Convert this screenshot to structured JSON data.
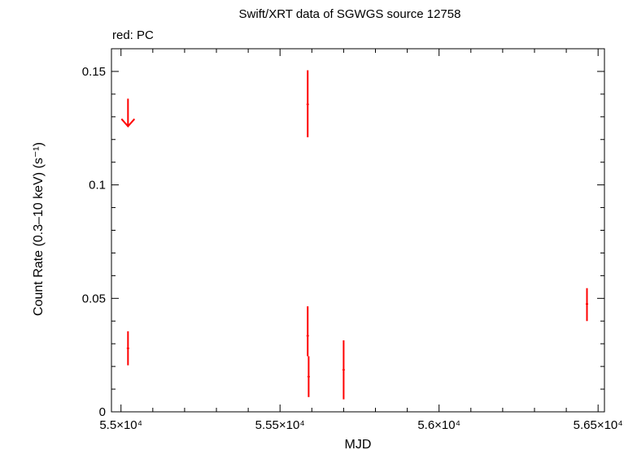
{
  "chart_data": {
    "type": "scatter",
    "title": "Swift/XRT data of SGWGS source 12758",
    "subtitle": "red: PC",
    "xlabel": "MJD",
    "ylabel": "Count Rate (0.3–10 keV) (s⁻¹)",
    "xlim": [
      54970,
      56520
    ],
    "ylim": [
      0,
      0.16
    ],
    "x_ticks": [
      {
        "value": 55000,
        "label": "5.5×10⁴"
      },
      {
        "value": 55500,
        "label": "5.55×10⁴"
      },
      {
        "value": 56000,
        "label": "5.6×10⁴"
      },
      {
        "value": 56500,
        "label": "5.65×10⁴"
      }
    ],
    "y_ticks": [
      {
        "value": 0,
        "label": "0"
      },
      {
        "value": 0.05,
        "label": "0.05"
      },
      {
        "value": 0.1,
        "label": "0.1"
      },
      {
        "value": 0.15,
        "label": "0.15"
      }
    ],
    "series": [
      {
        "color": "#ff0000",
        "points": [
          {
            "x": 55022,
            "y": 0.028,
            "y_low": 0.0205,
            "y_high": 0.0355
          },
          {
            "x": 55587,
            "y": 0.1355,
            "y_low": 0.121,
            "y_high": 0.1505
          },
          {
            "x": 55587,
            "y": 0.0335,
            "y_low": 0.0245,
            "y_high": 0.0465
          },
          {
            "x": 55590,
            "y": 0.0155,
            "y_low": 0.0065,
            "y_high": 0.0245
          },
          {
            "x": 55700,
            "y": 0.0185,
            "y_low": 0.0055,
            "y_high": 0.0315
          },
          {
            "x": 56465,
            "y": 0.0475,
            "y_low": 0.04,
            "y_high": 0.0545
          }
        ],
        "upper_limits": [
          {
            "x": 55022,
            "y": 0.138
          }
        ]
      }
    ],
    "grid": false,
    "legend": "top-left"
  }
}
